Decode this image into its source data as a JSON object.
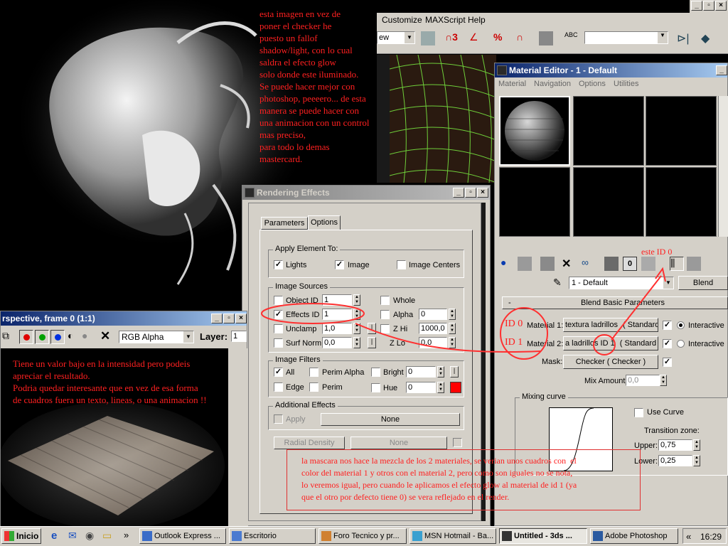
{
  "max_top": {
    "menu": [
      "Customize",
      "MAXScript",
      "Help"
    ],
    "view_dropdown": "ew"
  },
  "notes": {
    "top": "esta imagen en vez de\nponer el checker he\npuesto un fallof\nshadow/light, con lo cual\nsaldra el efecto glow\nsolo donde este iluminado.\nSe puede hacer mejor con\nphotoshop, peeeero... de esta\nmanera se puede hacer con\nuna animacion con un control\nmas preciso,\npara todo lo demas\nmastercard.",
    "left": "Tiene un valor bajo en la intensidad pero podeis\napreciar el resultado.\nPodria quedar interesante que en vez de esa forma\nde cuadros fuera un texto, lineas, o una animacion !!",
    "bottom": "la mascara nos hace la mezcla de los 2 materiales, se verian unos cuadros con  el\ncolor del material 1 y otros con el material 2, pero como son iguales no se nota,\nlo veremos igual, pero cuando le aplicamos el efecto glow al material de id 1 (ya\nque el otro por defecto tiene 0) se vera reflejado en el render.",
    "este_id": "este ID 0",
    "id0": "ID 0",
    "id1": "ID 1"
  },
  "frame_window": {
    "title": "rspective, frame 0 (1:1)",
    "channel": "RGB Alpha",
    "layer_label": "Layer:",
    "layer_value": "1"
  },
  "rendering_effects": {
    "title": "Rendering Effects",
    "tabs": [
      "Parameters",
      "Options"
    ],
    "apply_element": {
      "label": "Apply Element To:",
      "lights": "Lights",
      "image": "Image",
      "image_centers": "Image Centers"
    },
    "image_sources": {
      "label": "Image Sources",
      "object_id": "Object ID",
      "object_id_val": "1",
      "whole": "Whole",
      "effects_id": "Effects ID",
      "effects_id_val": "1",
      "alpha": "Alpha",
      "alpha_val": "0",
      "unclamp": "Unclamp",
      "unclamp_val": "1,0",
      "zhi": "Z Hi",
      "zhi_val": "1000,0",
      "surf_norm": "Surf Norm",
      "surf_norm_val": "0,0",
      "zlo": "Z Lo",
      "zlo_val": "0,0"
    },
    "image_filters": {
      "label": "Image Filters",
      "all": "All",
      "perim_alpha": "Perim Alpha",
      "bright": "Bright",
      "bright_val": "0",
      "edge": "Edge",
      "perim": "Perim",
      "hue": "Hue",
      "hue_val": "0",
      "hue_color": "#ff0000"
    },
    "additional": {
      "label": "Additional Effects",
      "apply": "Apply",
      "none1": "None",
      "radial": "Radial Density",
      "none2": "None"
    }
  },
  "material_editor": {
    "title": "Material Editor - 1 - Default",
    "menu": [
      "Material",
      "Navigation",
      "Options",
      "Utilities"
    ],
    "material_name": "1 - Default",
    "type_button": "Blend",
    "rollout": "Blend Basic Parameters",
    "mat1_label": "Material 1:",
    "mat1_name": "textura ladrillos",
    "mat1_type": "( Standard )",
    "mat2_label": "Material 2:",
    "mat2_name": "a ladrillos ID 1",
    "mat2_type": "( Standard )",
    "interactive": "Interactive",
    "mask_label": "Mask:",
    "mask_value": "Checker  ( Checker )",
    "mix_label": "Mix Amount:",
    "mix_value": "0,0",
    "mixing_curve": "Mixing curve",
    "use_curve": "Use Curve",
    "transition": "Transition zone:",
    "upper_label": "Upper:",
    "upper_value": "0,75",
    "lower_label": "Lower:",
    "lower_value": "0,25"
  },
  "taskbar": {
    "start": "Inicio",
    "buttons": [
      "Outlook Express ...",
      "Escritorio",
      "Foro Tecnico y pr...",
      "MSN Hotmail - Ba...",
      "Untitled - 3ds ...",
      "Adobe Photoshop"
    ],
    "chevron": "«",
    "clock": "16:29"
  }
}
